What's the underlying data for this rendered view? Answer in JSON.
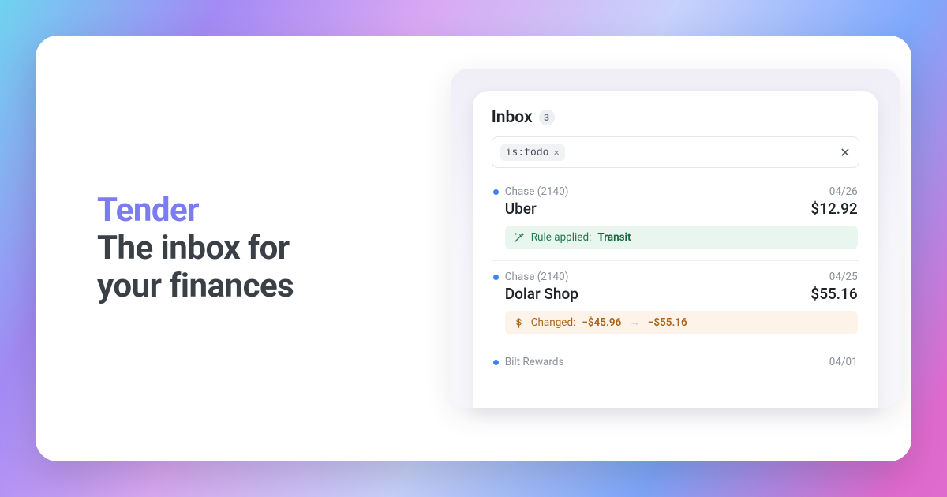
{
  "hero": {
    "brand": "Tender",
    "tagline_line1": "The inbox for",
    "tagline_line2": "your finances"
  },
  "inbox": {
    "title": "Inbox",
    "count": "3",
    "filter_chip": "is:todo",
    "items": [
      {
        "account": "Chase (2140)",
        "date": "04/26",
        "merchant": "Uber",
        "amount": "$12.92",
        "note": {
          "kind": "rule",
          "prefix": "Rule applied:",
          "value": "Transit"
        }
      },
      {
        "account": "Chase (2140)",
        "date": "04/25",
        "merchant": "Dolar Shop",
        "amount": "$55.16",
        "note": {
          "kind": "change",
          "prefix": "Changed:",
          "from": "−$45.96",
          "to": "−$55.16"
        }
      },
      {
        "account": "Bilt Rewards",
        "date": "04/01",
        "merchant": "",
        "amount": ""
      }
    ]
  }
}
